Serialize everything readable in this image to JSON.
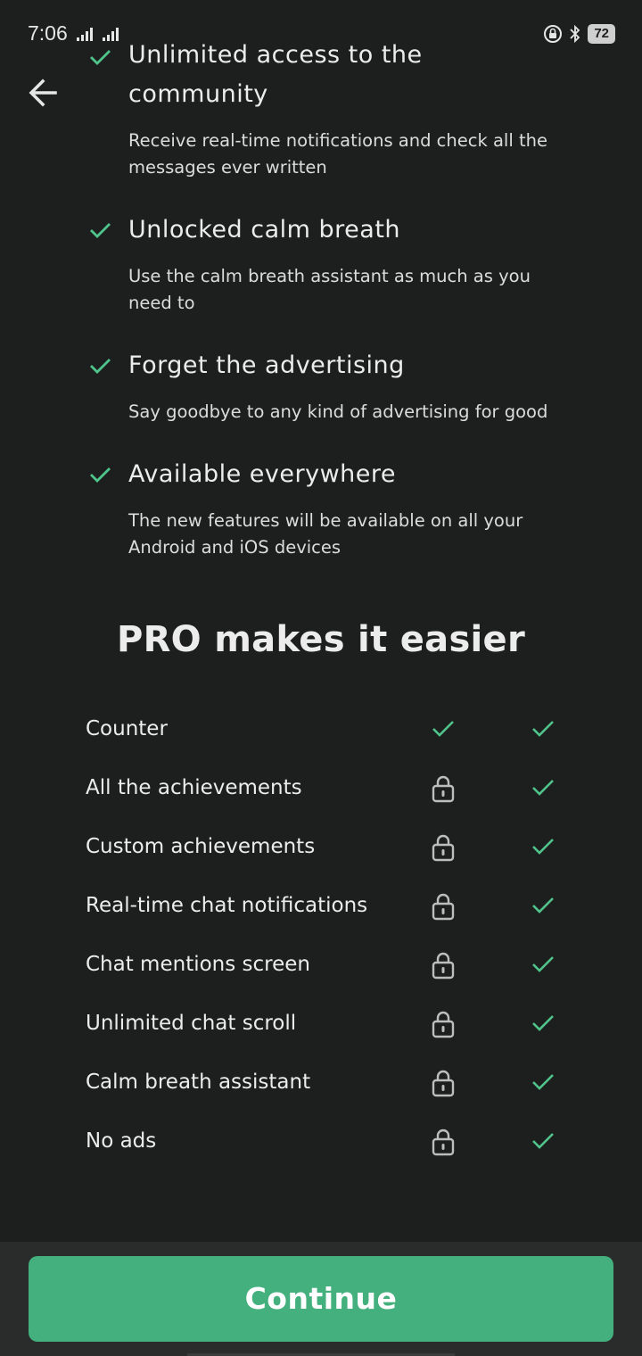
{
  "status_bar": {
    "time": "7:06",
    "battery": "72"
  },
  "features": [
    {
      "title_line1": "Unlimited access to the",
      "title_line2": "community",
      "description": "Receive real-time notifications and check all the messages ever written"
    },
    {
      "title": "Unlocked calm breath",
      "description": "Use the calm breath assistant as much as you need to"
    },
    {
      "title": "Forget the advertising",
      "description": "Say goodbye to any kind of advertising for good"
    },
    {
      "title": "Available everywhere",
      "description": "The new features will be available on all your Android and iOS devices"
    }
  ],
  "comparison": {
    "heading": "PRO makes it easier",
    "rows": [
      {
        "label": "Counter",
        "free": "check",
        "pro": "check"
      },
      {
        "label": "All the achievements",
        "free": "lock",
        "pro": "check"
      },
      {
        "label": "Custom achievements",
        "free": "lock",
        "pro": "check"
      },
      {
        "label": "Real-time chat notifications",
        "free": "lock",
        "pro": "check"
      },
      {
        "label": "Chat mentions screen",
        "free": "lock",
        "pro": "check"
      },
      {
        "label": "Unlimited chat scroll",
        "free": "lock",
        "pro": "check"
      },
      {
        "label": "Calm breath assistant",
        "free": "lock",
        "pro": "check"
      },
      {
        "label": "No ads",
        "free": "lock",
        "pro": "check"
      }
    ]
  },
  "continue_label": "Continue",
  "colors": {
    "accent": "#43b07e",
    "check": "#4fc48b",
    "background": "#1d1f1f"
  }
}
